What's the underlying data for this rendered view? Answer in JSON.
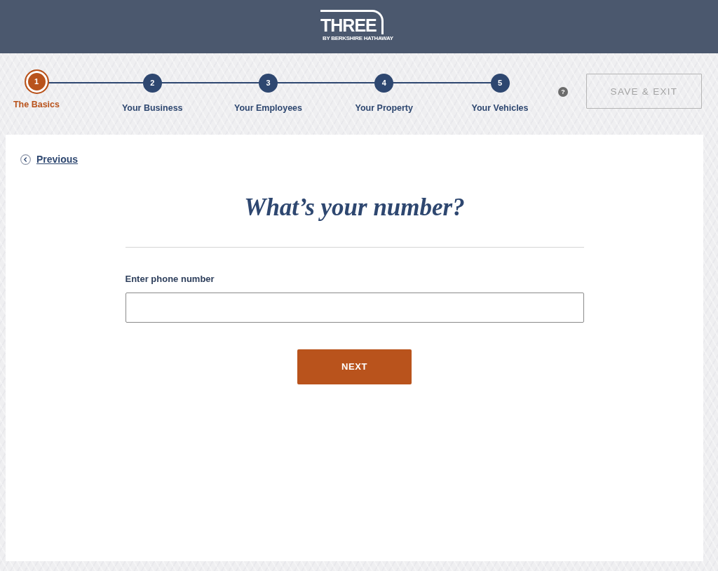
{
  "header": {
    "logo": {
      "wordmark": "THREE",
      "tagline": "BY BERKSHIRE HATHAWAY"
    }
  },
  "progress": {
    "steps": [
      {
        "number": "1",
        "label": "The Basics",
        "selected": true
      },
      {
        "number": "2",
        "label": "Your Business",
        "selected": false
      },
      {
        "number": "3",
        "label": "Your Employees",
        "selected": false
      },
      {
        "number": "4",
        "label": "Your Property",
        "selected": false
      },
      {
        "number": "5",
        "label": "Your Vehicles",
        "selected": false
      }
    ],
    "help": "?",
    "save_exit": {
      "label": "SAVE & EXIT",
      "disabled": true
    }
  },
  "form": {
    "previous_link": "Previous",
    "title": "What’s your number?",
    "field": {
      "label": "Enter phone number"
    },
    "next_button": "NEXT"
  }
}
